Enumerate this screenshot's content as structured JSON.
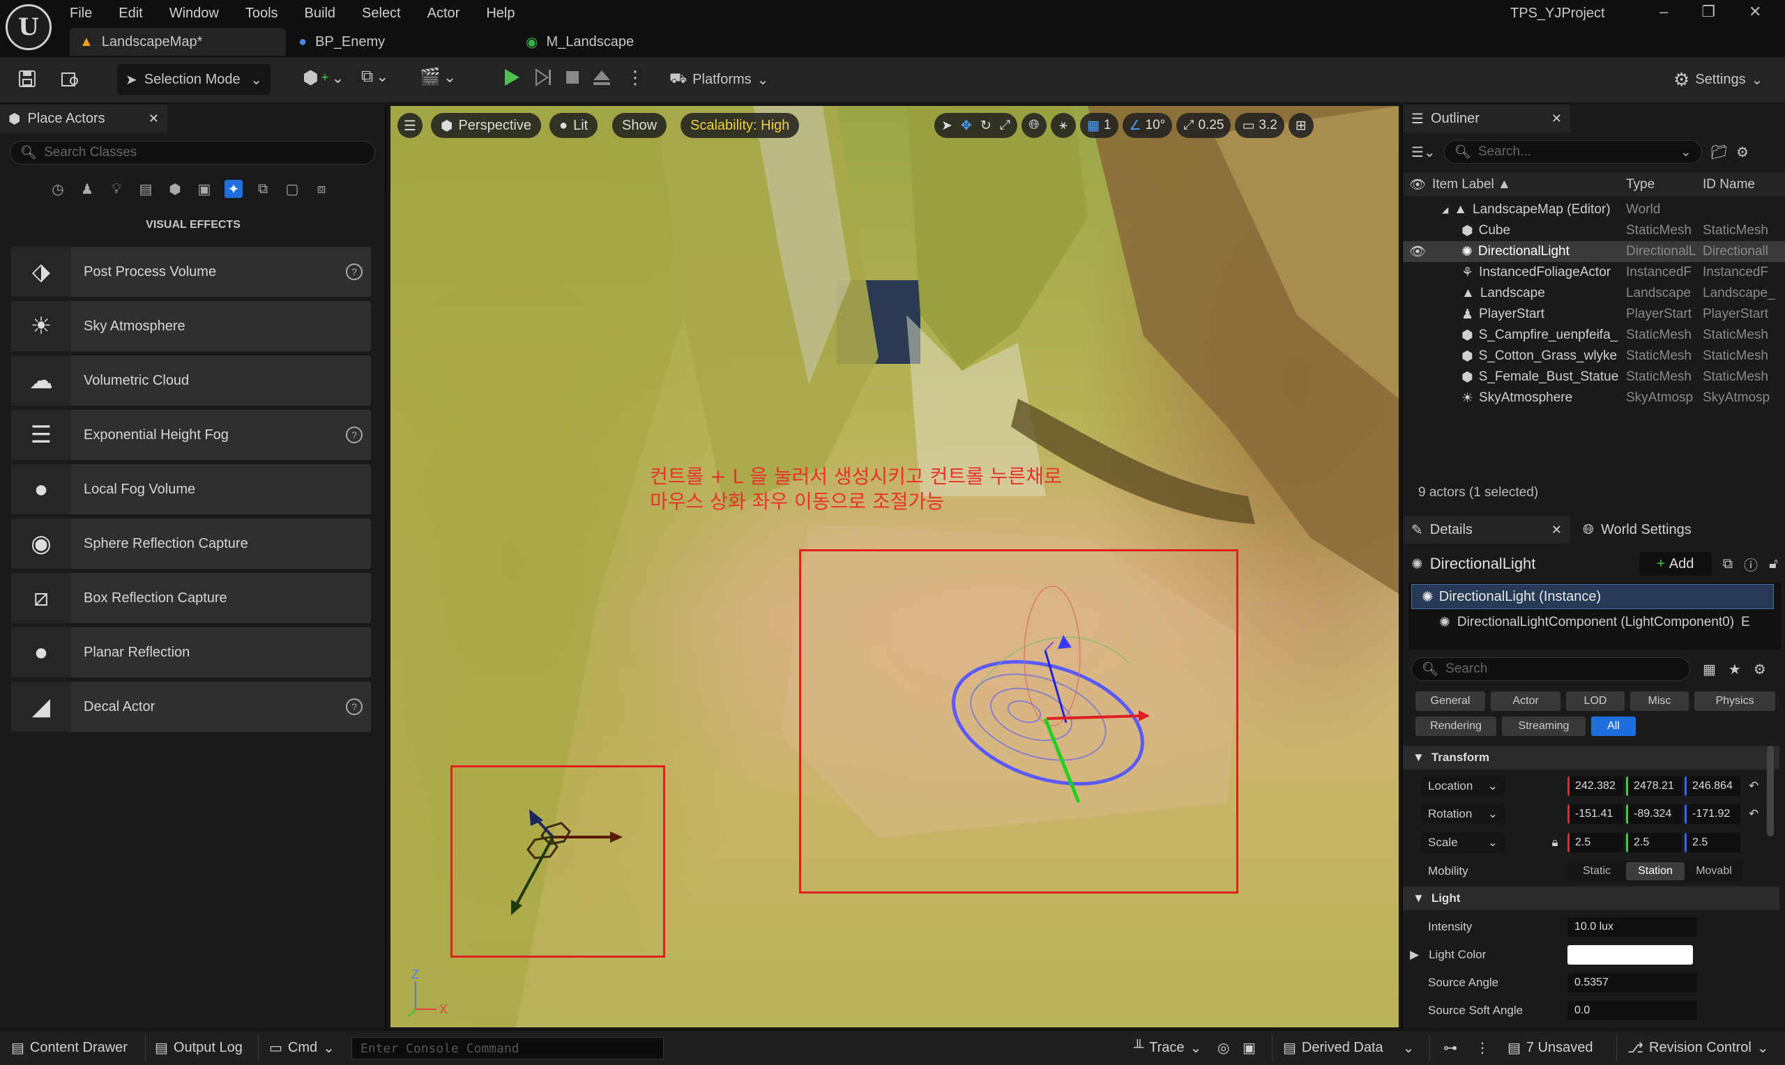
{
  "window": {
    "project": "TPS_YJProject",
    "minimize": "–",
    "restore": "❐",
    "close": "✕"
  },
  "menu": [
    "File",
    "Edit",
    "Window",
    "Tools",
    "Build",
    "Select",
    "Actor",
    "Help"
  ],
  "tabs": [
    {
      "label": "LandscapeMap*",
      "active": true
    },
    {
      "label": "BP_Enemy",
      "active": false
    },
    {
      "label": "M_Landscape",
      "active": false
    }
  ],
  "toolbar": {
    "selection_mode": "Selection Mode",
    "platforms": "Platforms",
    "settings": "Settings"
  },
  "place_actors": {
    "tab_label": "Place Actors",
    "search_placeholder": "Search Classes",
    "category": "VISUAL EFFECTS",
    "items": [
      {
        "label": "Post Process Volume",
        "icon": "post-process-icon",
        "help": true
      },
      {
        "label": "Sky Atmosphere",
        "icon": "sky-atmosphere-icon",
        "help": false
      },
      {
        "label": "Volumetric Cloud",
        "icon": "cloud-icon",
        "help": false
      },
      {
        "label": "Exponential Height Fog",
        "icon": "fog-icon",
        "help": true
      },
      {
        "label": "Local Fog Volume",
        "icon": "sphere-icon",
        "help": false
      },
      {
        "label": "Sphere Reflection Capture",
        "icon": "sphere-icon",
        "help": false
      },
      {
        "label": "Box Reflection Capture",
        "icon": "box-capture-icon",
        "help": false
      },
      {
        "label": "Planar Reflection",
        "icon": "sphere-icon",
        "help": false
      },
      {
        "label": "Decal Actor",
        "icon": "decal-icon",
        "help": true
      }
    ]
  },
  "viewport": {
    "perspective": "Perspective",
    "lit": "Lit",
    "show": "Show",
    "scalability": "Scalability: High",
    "grid_snap": "1",
    "rot_snap": "10°",
    "scale_snap": "0.25",
    "cam_speed": "3.2",
    "annotation_line1": "컨트롤 + L 을 눌러서 생성시키고 컨트롤 누른채로",
    "annotation_line2": "마우스 상화 좌우 이동으로  조절가능",
    "axis_z": "Z",
    "axis_x": "X",
    "accent": "#e0201a"
  },
  "outliner": {
    "tab_label": "Outliner",
    "search_placeholder": "Search...",
    "col_label": "Item Label ▲",
    "col_type": "Type",
    "col_id": "ID Name",
    "rows": [
      {
        "label": "LandscapeMap (Editor)",
        "type": "World",
        "id": "",
        "indent": 1,
        "selected": false
      },
      {
        "label": "Cube",
        "type": "StaticMesh",
        "id": "StaticMesh",
        "indent": 2,
        "selected": false
      },
      {
        "label": "DirectionalLight",
        "type": "DirectionalL",
        "id": "Directionall",
        "indent": 2,
        "selected": true
      },
      {
        "label": "InstancedFoliageActor",
        "type": "InstancedF",
        "id": "InstancedF",
        "indent": 2,
        "selected": false
      },
      {
        "label": "Landscape",
        "type": "Landscape",
        "id": "Landscape_",
        "indent": 2,
        "selected": false
      },
      {
        "label": "PlayerStart",
        "type": "PlayerStart",
        "id": "PlayerStart",
        "indent": 2,
        "selected": false
      },
      {
        "label": "S_Campfire_uenpfeifa_",
        "type": "StaticMesh",
        "id": "StaticMesh",
        "indent": 2,
        "selected": false
      },
      {
        "label": "S_Cotton_Grass_wlyke",
        "type": "StaticMesh",
        "id": "StaticMesh",
        "indent": 2,
        "selected": false
      },
      {
        "label": "S_Female_Bust_Statue",
        "type": "StaticMesh",
        "id": "StaticMesh",
        "indent": 2,
        "selected": false
      },
      {
        "label": "SkyAtmosphere",
        "type": "SkyAtmosp",
        "id": "SkyAtmosp",
        "indent": 2,
        "selected": false
      }
    ],
    "count": "9 actors (1 selected)"
  },
  "details": {
    "tab_label": "Details",
    "world_settings": "World Settings",
    "title": "DirectionalLight",
    "add": "Add",
    "instance": "DirectionalLight (Instance)",
    "component": "DirectionalLightComponent (LightComponent0)",
    "component_suffix": "E",
    "search_placeholder": "Search",
    "filters_row1": [
      "General",
      "Actor",
      "LOD",
      "Misc",
      "Physics"
    ],
    "filters_row2": [
      "Rendering",
      "Streaming",
      "All"
    ],
    "transform": "Transform",
    "location": {
      "label": "Location",
      "x": "242.382",
      "y": "2478.21",
      "z": "246.864"
    },
    "rotation": {
      "label": "Rotation",
      "x": "-151.41",
      "y": "-89.324",
      "z": "-171.92"
    },
    "scale": {
      "label": "Scale",
      "x": "2.5",
      "y": "2.5",
      "z": "2.5"
    },
    "mobility": {
      "label": "Mobility",
      "options": [
        "Static",
        "Station",
        "Movabl"
      ],
      "selected": 1
    },
    "light": "Light",
    "intensity": {
      "label": "Intensity",
      "value": "10.0 lux"
    },
    "light_color": {
      "label": "Light Color",
      "value": "#ffffff"
    },
    "source_angle": {
      "label": "Source Angle",
      "value": "0.5357"
    },
    "source_soft_angle": {
      "label": "Source Soft Angle",
      "value": "0.0"
    }
  },
  "bottom": {
    "content_drawer": "Content Drawer",
    "output_log": "Output Log",
    "cmd": "Cmd",
    "console_placeholder": "Enter Console Command",
    "trace": "Trace",
    "derived_data": "Derived Data",
    "unsaved": "7 Unsaved",
    "revision": "Revision Control"
  }
}
